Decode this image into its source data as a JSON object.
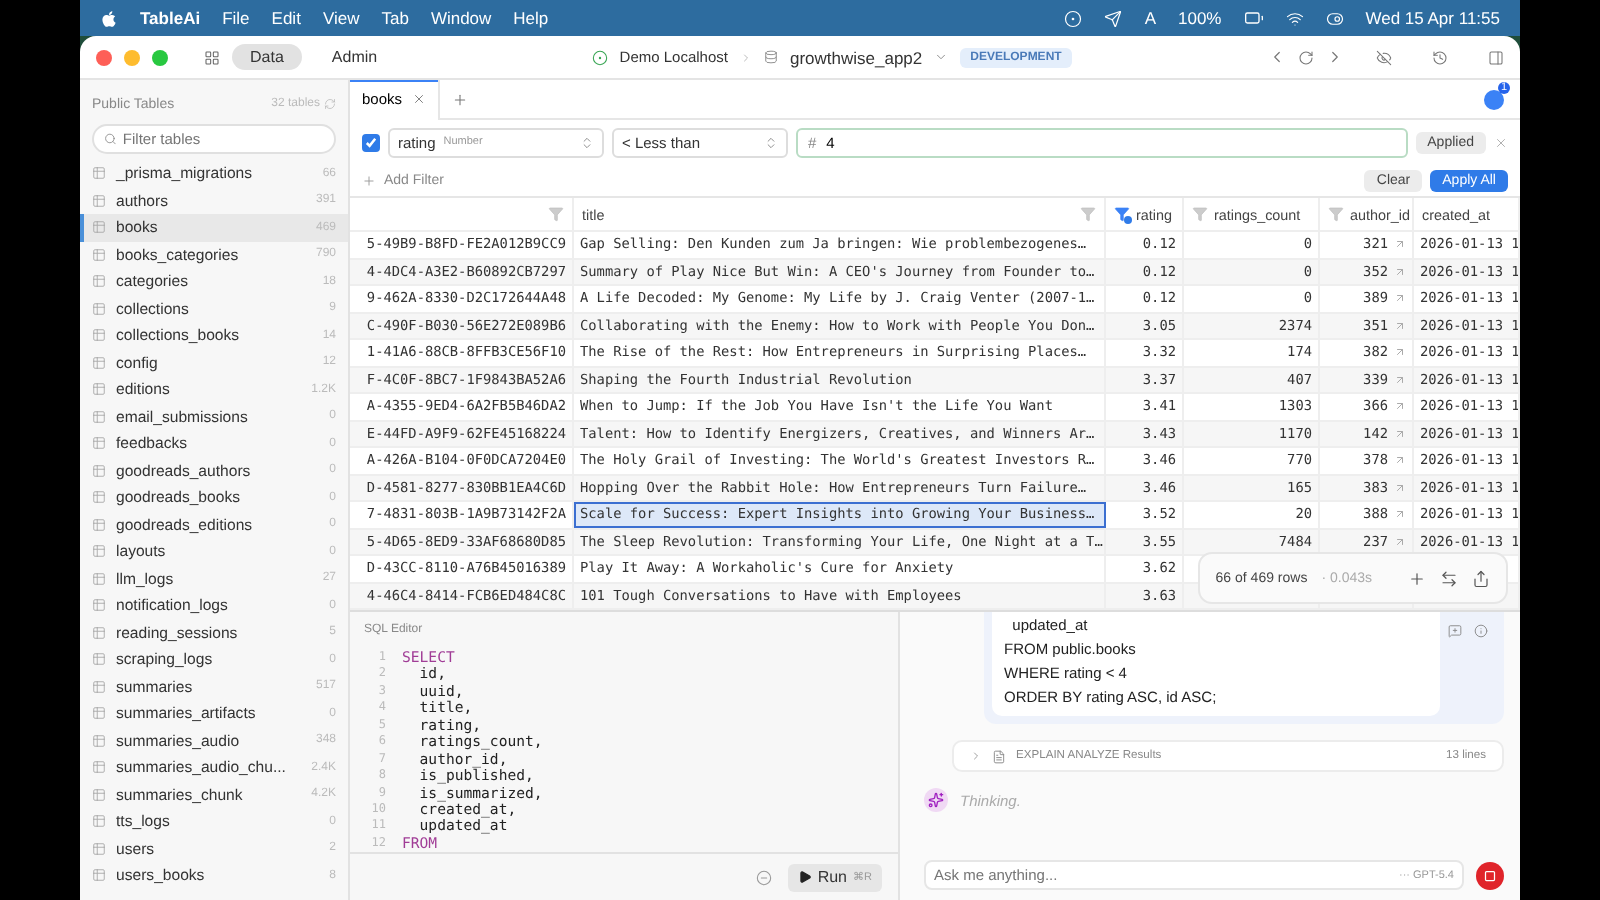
{
  "menu_bar": {
    "app": "TableAi",
    "items": [
      "File",
      "Edit",
      "View",
      "Tab",
      "Window",
      "Help"
    ],
    "input_source": "A",
    "battery": "100%",
    "clock": "Wed 15 Apr 11:55"
  },
  "titlebar": {
    "modes": [
      {
        "label": "Data",
        "selected": true
      },
      {
        "label": "Admin",
        "selected": false
      }
    ],
    "connection": "Demo Localhost",
    "database": "growthwise_app2",
    "environment": "DEVELOPMENT"
  },
  "sidebar": {
    "title": "Public Tables",
    "count": "32 tables",
    "search": {
      "placeholder": "Filter tables"
    },
    "items": [
      {
        "name": "_prisma_migrations",
        "count": "66",
        "selected": false
      },
      {
        "name": "authors",
        "count": "391",
        "selected": false
      },
      {
        "name": "books",
        "count": "469",
        "selected": true
      },
      {
        "name": "books_categories",
        "count": "790",
        "selected": false
      },
      {
        "name": "categories",
        "count": "18",
        "selected": false
      },
      {
        "name": "collections",
        "count": "9",
        "selected": false
      },
      {
        "name": "collections_books",
        "count": "14",
        "selected": false
      },
      {
        "name": "config",
        "count": "12",
        "selected": false
      },
      {
        "name": "editions",
        "count": "1.2K",
        "selected": false
      },
      {
        "name": "email_submissions",
        "count": "0",
        "selected": false
      },
      {
        "name": "feedbacks",
        "count": "0",
        "selected": false
      },
      {
        "name": "goodreads_authors",
        "count": "0",
        "selected": false
      },
      {
        "name": "goodreads_books",
        "count": "0",
        "selected": false
      },
      {
        "name": "goodreads_editions",
        "count": "0",
        "selected": false
      },
      {
        "name": "layouts",
        "count": "0",
        "selected": false
      },
      {
        "name": "llm_logs",
        "count": "27",
        "selected": false
      },
      {
        "name": "notification_logs",
        "count": "0",
        "selected": false
      },
      {
        "name": "reading_sessions",
        "count": "5",
        "selected": false
      },
      {
        "name": "scraping_logs",
        "count": "0",
        "selected": false
      },
      {
        "name": "summaries",
        "count": "517",
        "selected": false
      },
      {
        "name": "summaries_artifacts",
        "count": "0",
        "selected": false
      },
      {
        "name": "summaries_audio",
        "count": "348",
        "selected": false
      },
      {
        "name": "summaries_audio_chu...",
        "count": "2.4K",
        "selected": false
      },
      {
        "name": "summaries_chunk",
        "count": "4.2K",
        "selected": false
      },
      {
        "name": "tts_logs",
        "count": "0",
        "selected": false
      },
      {
        "name": "users",
        "count": "2",
        "selected": false
      },
      {
        "name": "users_books",
        "count": "8",
        "selected": false
      }
    ]
  },
  "tabs": [
    {
      "label": "books",
      "selected": true
    }
  ],
  "notifications": "1",
  "filter": {
    "enabled": true,
    "column": "rating",
    "column_type": "Number",
    "operator": "< Less than",
    "value_prefix": "#",
    "value": "4",
    "status": "Applied",
    "add_label": "Add Filter",
    "clear_label": "Clear",
    "apply_label": "Apply All"
  },
  "table": {
    "columns": [
      {
        "kind": "uuid",
        "sorted": false
      },
      {
        "label": "title",
        "kind": "text",
        "sorted": false
      },
      {
        "label": "rating",
        "kind": "number",
        "sorted": true
      },
      {
        "label": "ratings_count",
        "kind": "number",
        "sorted": false
      },
      {
        "label": "author_id",
        "kind": "fk",
        "sorted": false
      },
      {
        "label": "created_at",
        "kind": "date",
        "sorted": false
      }
    ],
    "rows": [
      {
        "selected": false,
        "cells": [
          "5-49B9-B8FD-FE2A012B9CC9",
          "Gap Selling: Den Kunden zum Ja bringen: Wie problembezogenes…",
          "0.12",
          "0",
          "321",
          "2026-01-13 1"
        ]
      },
      {
        "selected": false,
        "cells": [
          "4-4DC4-A3E2-B60892CB7297",
          "Summary of Play Nice But Win: A CEO's Journey from Founder to…",
          "0.12",
          "0",
          "352",
          "2026-01-13 1"
        ]
      },
      {
        "selected": false,
        "cells": [
          "9-462A-8330-D2C172644A48",
          "A Life Decoded: My Genome: My Life by J. Craig Venter (2007-1…",
          "0.12",
          "0",
          "389",
          "2026-01-13 1"
        ]
      },
      {
        "selected": false,
        "cells": [
          "C-490F-B030-56E272E089B6",
          "Collaborating with the Enemy: How to Work with People You Don…",
          "3.05",
          "2374",
          "351",
          "2026-01-13 1"
        ]
      },
      {
        "selected": false,
        "cells": [
          "1-41A6-88CB-8FFB3CE56F10",
          "The Rise of the Rest: How Entrepreneurs in Surprising Places…",
          "3.32",
          "174",
          "382",
          "2026-01-13 1"
        ]
      },
      {
        "selected": false,
        "cells": [
          "F-4C0F-8BC7-1F9843BA52A6",
          "Shaping the Fourth Industrial Revolution",
          "3.37",
          "407",
          "339",
          "2026-01-13 1"
        ]
      },
      {
        "selected": false,
        "cells": [
          "A-4355-9ED4-6A2FB5B46DA2",
          "When to Jump: If the Job You Have Isn't the Life You Want",
          "3.41",
          "1303",
          "366",
          "2026-01-13 1"
        ]
      },
      {
        "selected": false,
        "cells": [
          "E-44FD-A9F9-62FE45168224",
          "Talent: How to Identify Energizers, Creatives, and Winners Ar…",
          "3.43",
          "1170",
          "142",
          "2026-01-13 1"
        ]
      },
      {
        "selected": false,
        "cells": [
          "A-426A-B104-0F0DCA7204E0",
          "The Holy Grail of Investing: The World's Greatest Investors R…",
          "3.46",
          "770",
          "378",
          "2026-01-13 1"
        ]
      },
      {
        "selected": false,
        "cells": [
          "D-4581-8277-830BB1EA4C6D",
          "Hopping Over the Rabbit Hole: How Entrepreneurs Turn Failure…",
          "3.46",
          "165",
          "383",
          "2026-01-13 1"
        ]
      },
      {
        "selected": true,
        "cells": [
          "7-4831-803B-1A9B73142F2A",
          "Scale for Success: Expert Insights into Growing Your Business…",
          "3.52",
          "20",
          "388",
          "2026-01-13 1"
        ]
      },
      {
        "selected": false,
        "cells": [
          "5-4D65-8ED9-33AF68680D85",
          "The Sleep Revolution: Transforming Your Life, One Night at a T…",
          "3.55",
          "7484",
          "237",
          "2026-01-13 1"
        ]
      },
      {
        "selected": false,
        "cells": [
          "D-43CC-8110-A76B45016389",
          "Play It Away: A Workaholic's Cure for Anxiety",
          "3.62"
        ]
      },
      {
        "selected": false,
        "cells": [
          "4-46C4-8414-FCB6ED484C8C",
          "101 Tough Conversations to Have with Employees",
          "3.63"
        ]
      }
    ],
    "row_count": "66 of 469 rows",
    "timing": "· 0.043s"
  },
  "sql_editor": {
    "title": "SQL Editor",
    "lines": [
      {
        "number": "1",
        "text": "SELECT",
        "kind": "keyword"
      },
      {
        "number": "2",
        "text": "  id,",
        "kind": "plain"
      },
      {
        "number": "3",
        "text": "  uuid,",
        "kind": "plain"
      },
      {
        "number": "4",
        "text": "  title,",
        "kind": "plain"
      },
      {
        "number": "5",
        "text": "  rating,",
        "kind": "plain"
      },
      {
        "number": "6",
        "text": "  ratings_count,",
        "kind": "plain"
      },
      {
        "number": "7",
        "text": "  author_id,",
        "kind": "plain"
      },
      {
        "number": "8",
        "text": "  is_published,",
        "kind": "plain"
      },
      {
        "number": "9",
        "text": "  is_summarized,",
        "kind": "plain"
      },
      {
        "number": "10",
        "text": "  created_at,",
        "kind": "plain"
      },
      {
        "number": "11",
        "text": "  updated_at",
        "kind": "plain"
      },
      {
        "number": "12",
        "text": "FROM",
        "kind": "keyword"
      }
    ],
    "run_label": "Run",
    "run_shortcut": "⌘R"
  },
  "assistant": {
    "code_lines": [
      "  updated_at",
      "FROM public.books",
      "WHERE rating < 4",
      "ORDER BY rating ASC, id ASC;"
    ],
    "result": {
      "title": "EXPLAIN ANALYZE Results",
      "count": "13 lines"
    },
    "status": "Thinking.",
    "input": {
      "placeholder": "Ask me anything...",
      "model": "··· GPT-5.4"
    }
  }
}
